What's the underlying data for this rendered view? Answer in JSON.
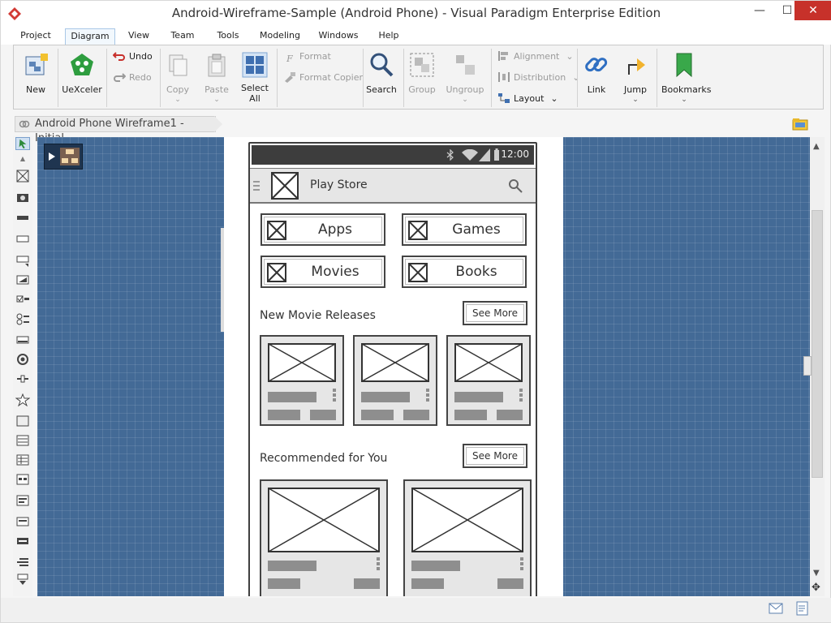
{
  "window": {
    "title": "Android-Wireframe-Sample (Android Phone) - Visual Paradigm Enterprise Edition",
    "minimize": "—",
    "maximize": "☐",
    "close": "✕"
  },
  "menu": {
    "tabs": [
      {
        "label": "Project"
      },
      {
        "label": "Diagram"
      },
      {
        "label": "View"
      },
      {
        "label": "Team"
      },
      {
        "label": "Tools"
      },
      {
        "label": "Modeling"
      },
      {
        "label": "Windows"
      },
      {
        "label": "Help"
      }
    ],
    "active_tab": "Diagram"
  },
  "ribbon": {
    "new": "New",
    "uexceler": "UeXceler",
    "undo": "Undo",
    "redo": "Redo",
    "copy": "Copy",
    "paste": "Paste",
    "select_all": "Select All",
    "format": "Format",
    "format_copier": "Format Copier",
    "search": "Search",
    "group": "Group",
    "ungroup": "Ungroup",
    "alignment": "Alignment",
    "distribution": "Distribution",
    "layout": "Layout",
    "link": "Link",
    "jump": "Jump",
    "bookmarks": "Bookmarks"
  },
  "breadcrumb": {
    "label": "Android Phone Wireframe1 - Initial"
  },
  "phone": {
    "time": "12:00",
    "app_title": "Play Store",
    "categories": [
      "Apps",
      "Games",
      "Movies",
      "Books"
    ],
    "section1_title": "New Movie Releases",
    "section2_title": "Recommended for You",
    "see_more": "See More"
  },
  "colors": {
    "canvas": "#436a96",
    "close_button": "#c7312a",
    "active_tab_border": "#a8c7e6"
  }
}
